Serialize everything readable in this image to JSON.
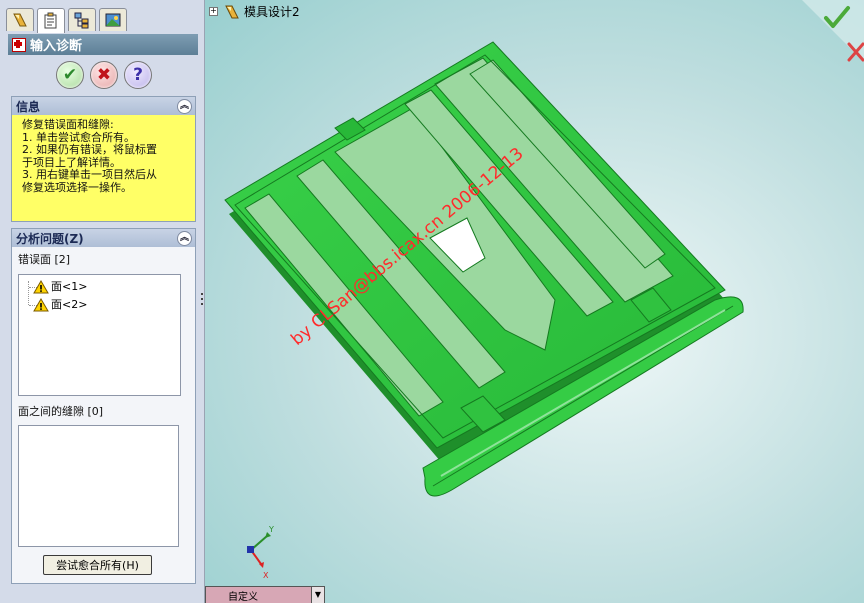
{
  "property_manager": {
    "title": "输入诊断",
    "tabs": [
      "feature-manager-icon",
      "property-manager-icon",
      "configuration-manager-icon",
      "display-manager-icon"
    ],
    "actions": {
      "ok": "✔",
      "cancel": "✖",
      "help": "?"
    }
  },
  "info": {
    "title": "信息",
    "lines": [
      "修复错误面和缝隙:",
      "  1. 单击尝试愈合所有。",
      "  2. 如果仍有错误，将鼠标置",
      "于项目上了解详情。",
      "  3. 用右键单击一项目然后从",
      "修复选项选择一操作。"
    ]
  },
  "analysis": {
    "title": "分析问题(Z)",
    "faulty_faces_label": "错误面 [2]",
    "faces": [
      "面<1>",
      "面<2>"
    ],
    "gaps_label": "面之间的缝隙 [0]",
    "try_heal_button": "尝试愈合所有(H)"
  },
  "graphics": {
    "tree_root": "模具设计2",
    "watermark": "by CLSan@bbs.icax.cn 2006-12-13",
    "config_tab": "自定义",
    "model_color": "#33cc44",
    "triad_labels": {
      "x": "X",
      "y": "Y"
    }
  }
}
